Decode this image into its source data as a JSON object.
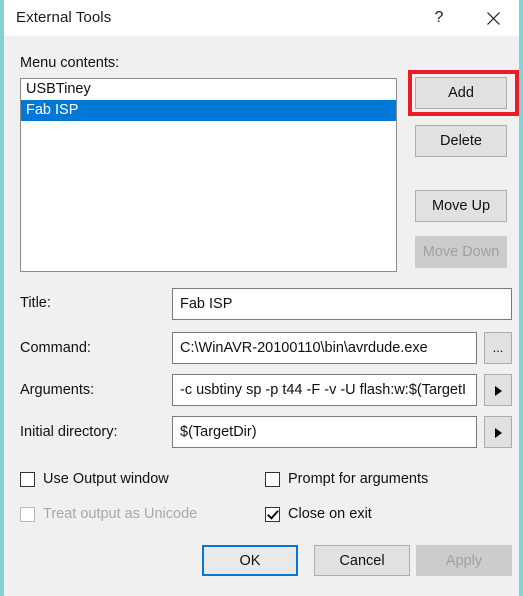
{
  "window": {
    "title": "External Tools",
    "help_icon": "question-mark-icon",
    "close_icon": "close-icon"
  },
  "menu_contents": {
    "label": "Menu contents:",
    "items": [
      {
        "label": "USBTiney",
        "selected": false
      },
      {
        "label": "Fab ISP",
        "selected": true
      }
    ]
  },
  "side_buttons": {
    "add": "Add",
    "delete": "Delete",
    "move_up": "Move Up",
    "move_down": "Move Down"
  },
  "annotation": {
    "target": "Add",
    "color": "#ec1c24"
  },
  "fields": {
    "title": {
      "label": "Title:",
      "value": "Fab ISP"
    },
    "command": {
      "label": "Command:",
      "value": "C:\\WinAVR-20100110\\bin\\avrdude.exe",
      "browse_label": "..."
    },
    "arguments": {
      "label": "Arguments:",
      "value": "-c usbtiny sp -p t44 -F -v -U flash:w:$(TargetI"
    },
    "initial_directory": {
      "label": "Initial directory:",
      "value": "$(TargetDir)"
    }
  },
  "checkboxes": {
    "use_output_window": {
      "label": "Use Output window",
      "checked": false,
      "disabled": false
    },
    "treat_output_as_unicode": {
      "label": "Treat output as Unicode",
      "checked": false,
      "disabled": true
    },
    "prompt_for_arguments": {
      "label": "Prompt for arguments",
      "checked": false,
      "disabled": false
    },
    "close_on_exit": {
      "label": "Close on exit",
      "checked": true,
      "disabled": false
    }
  },
  "footer": {
    "ok": "OK",
    "cancel": "Cancel",
    "apply": "Apply"
  },
  "colors": {
    "selection": "#0078d7",
    "dialog_background": "#f0f0f0",
    "annotation_red": "#ec1c24",
    "focus_blue": "#0078d7"
  }
}
